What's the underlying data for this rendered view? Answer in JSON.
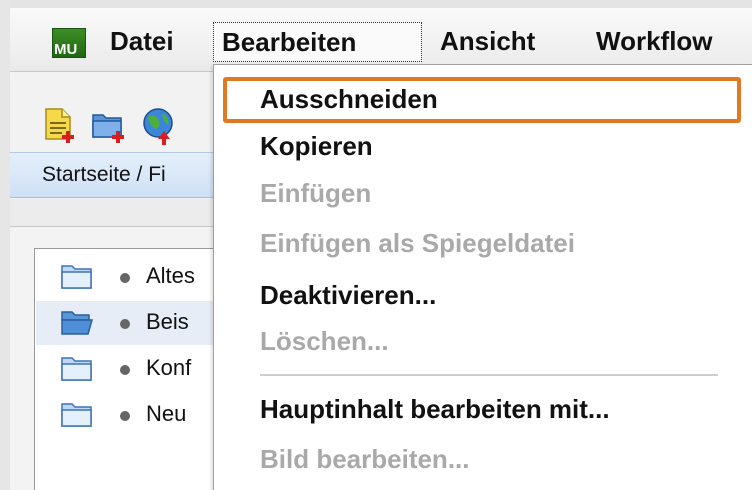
{
  "menubar": {
    "logo_text": "MU",
    "items": [
      {
        "label": "Datei"
      },
      {
        "label": "Bearbeiten"
      },
      {
        "label": "Ansicht"
      },
      {
        "label": "Workflow"
      }
    ]
  },
  "toolbar": {
    "icons": [
      "new-document-icon",
      "new-folder-icon",
      "globe-upload-icon"
    ]
  },
  "breadcrumb": "Startseite / Fi",
  "tree": {
    "items": [
      {
        "name": "Altes",
        "icon": "folder-icon",
        "selected": false
      },
      {
        "name": "Beis",
        "icon": "folder-open-icon",
        "selected": true
      },
      {
        "name": "Konf",
        "icon": "folder-icon",
        "selected": false
      },
      {
        "name": "Neu",
        "icon": "folder-icon",
        "selected": false
      }
    ]
  },
  "edit_menu": {
    "items": [
      {
        "label": "Ausschneiden",
        "enabled": true,
        "highlighted": true
      },
      {
        "label": "Kopieren",
        "enabled": true
      },
      {
        "label": "Einfügen",
        "enabled": false
      },
      {
        "label": "Einfügen als Spiegeldatei",
        "enabled": false
      },
      {
        "label": "Deaktivieren...",
        "enabled": true
      },
      {
        "label": "Löschen...",
        "enabled": false
      },
      {
        "label": "Hauptinhalt bearbeiten mit...",
        "enabled": true
      },
      {
        "label": "Bild bearbeiten...",
        "enabled": false
      }
    ]
  },
  "colors": {
    "highlight_border": "#e0791f",
    "logo_green": "#2e7d1c",
    "breadcrumb_bg": "#d6e5f8",
    "disabled_text": "#a9a9a9"
  }
}
